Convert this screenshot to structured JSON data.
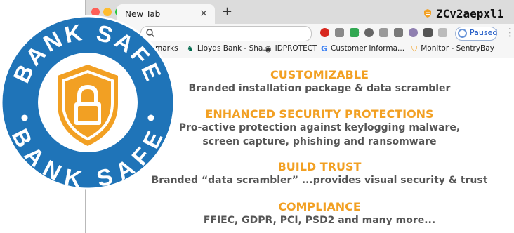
{
  "browser": {
    "tab_title": "New Tab",
    "tab_close": "×",
    "new_tab": "+",
    "status_text": "ZCv2aepxl1",
    "omnibox_value": "",
    "paused_label": "Paused",
    "menu_glyph": "⋮",
    "bookmarks": [
      {
        "label": "Bookmarks",
        "icon": "star-icon"
      },
      {
        "label": "Lloyds Bank - Sha...",
        "icon": "horse-icon"
      },
      {
        "label": "IDPROTECT",
        "icon": "globe-icon"
      },
      {
        "label": "Customer Informa...",
        "icon": "google-icon"
      },
      {
        "label": "Monitor - SentryBay",
        "icon": "shield-icon"
      }
    ],
    "bookmarks_partial": "s"
  },
  "features": [
    {
      "title": "CUSTOMIZABLE",
      "lines": [
        "Branded installation package & data scrambler"
      ]
    },
    {
      "title": "ENHANCED SECURITY PROTECTIONS",
      "lines": [
        "Pro-active protection against keylogging malware,",
        "screen capture, phishing and ransomware"
      ]
    },
    {
      "title": "BUILD TRUST",
      "lines": [
        "Branded “data scrambler” ...provides visual security & trust"
      ]
    },
    {
      "title": "COMPLIANCE",
      "lines": [
        "FFIEC, GDPR, PCI, PSD2 and many more..."
      ]
    }
  ],
  "badge": {
    "top_text": "BANK SAFE",
    "bottom_text": "BANK SAFE"
  },
  "colors": {
    "accent": "#f2a023",
    "badge_blue": "#1f74b8",
    "text_gray": "#555555"
  }
}
